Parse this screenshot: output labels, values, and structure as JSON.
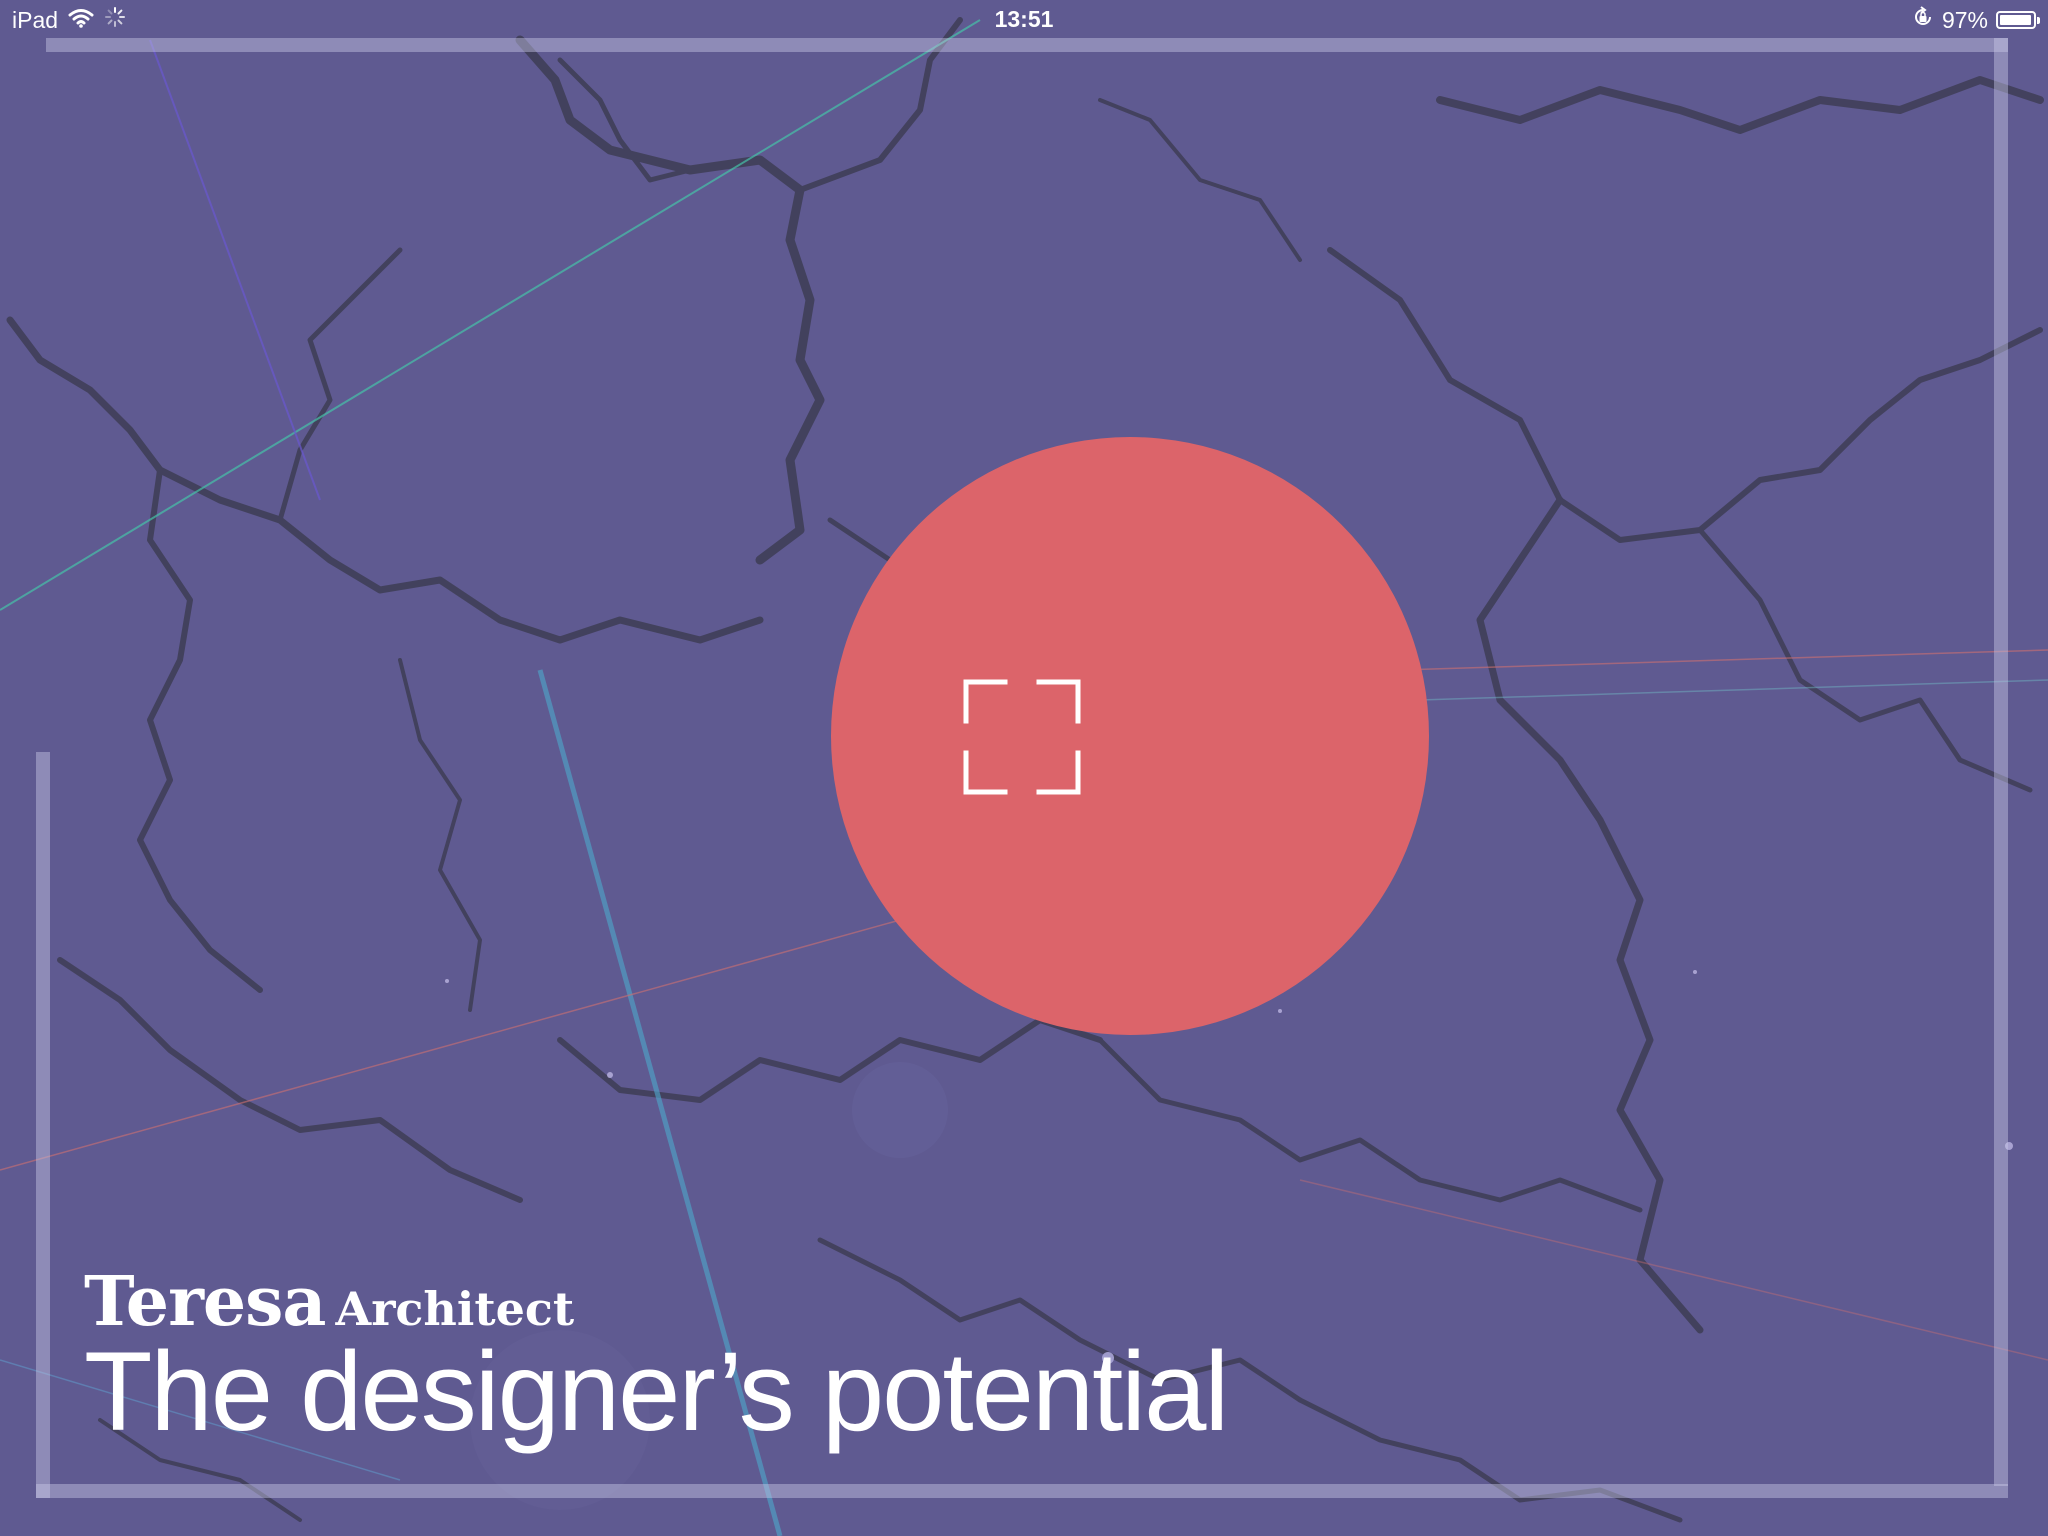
{
  "status_bar": {
    "device": "iPad",
    "time": "13:51",
    "battery": "97%",
    "battery_level": 0.97,
    "icons": [
      "wifi-icon",
      "activity-spinner-icon",
      "rotation-lock-icon",
      "battery-icon"
    ]
  },
  "hero": {
    "button_icon": "expand-icon",
    "button_color": "#dc646a"
  },
  "title": {
    "name": "Teresa",
    "role": "Architect",
    "tagline": "The designer’s potential"
  },
  "colors": {
    "background": "#5f5a91",
    "frame": "#c8c8e6",
    "text": "#ffffff"
  }
}
